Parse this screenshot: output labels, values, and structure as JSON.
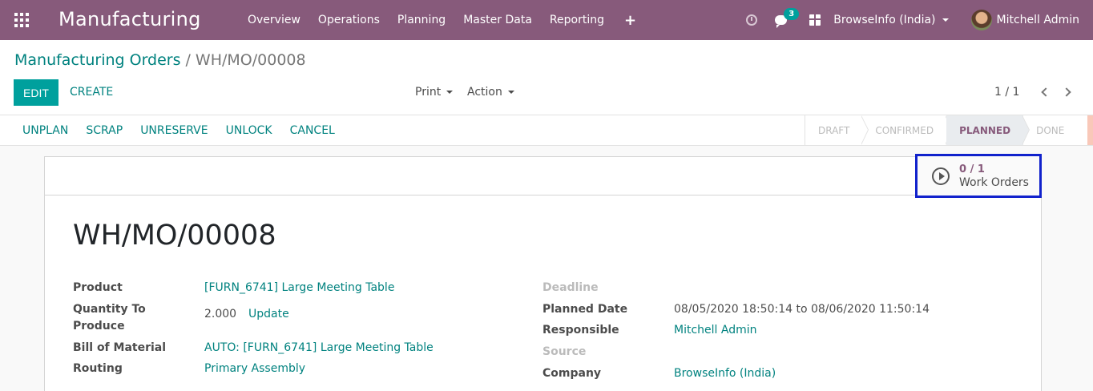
{
  "navbar": {
    "app_title": "Manufacturing",
    "menu": [
      "Overview",
      "Operations",
      "Planning",
      "Master Data",
      "Reporting"
    ],
    "plus": "+",
    "chat_badge": "3",
    "company": "BrowseInfo (India)",
    "user": "Mitchell Admin",
    "color": "#875a7b"
  },
  "control_panel": {
    "breadcrumb_parent": "Manufacturing Orders",
    "breadcrumb_sep": "/",
    "breadcrumb_current": "WH/MO/00008",
    "edit": "EDIT",
    "create": "CREATE",
    "print": "Print",
    "action": "Action",
    "pager": "1 / 1"
  },
  "statusbar": {
    "actions": [
      "UNPLAN",
      "SCRAP",
      "UNRESERVE",
      "UNLOCK",
      "CANCEL"
    ],
    "stages": [
      "DRAFT",
      "CONFIRMED",
      "PLANNED",
      "DONE"
    ],
    "active_stage": "PLANNED"
  },
  "smart_button": {
    "count": "0 / 1",
    "label": "Work Orders"
  },
  "record": {
    "title": "WH/MO/00008",
    "left": {
      "product_label": "Product",
      "product_value": "[FURN_6741] Large Meeting Table",
      "qty_label_1": "Quantity To",
      "qty_label_2": "Produce",
      "qty_value": "2.000",
      "qty_update": "Update",
      "bom_label": "Bill of Material",
      "bom_value": "AUTO: [FURN_6741] Large Meeting Table",
      "routing_label": "Routing",
      "routing_value": "Primary Assembly"
    },
    "right": {
      "deadline_label": "Deadline",
      "planned_label": "Planned Date",
      "planned_value": "08/05/2020 18:50:14 to 08/06/2020 11:50:14",
      "responsible_label": "Responsible",
      "responsible_value": "Mitchell Admin",
      "source_label": "Source",
      "company_label": "Company",
      "company_value": "BrowseInfo (India)"
    }
  }
}
